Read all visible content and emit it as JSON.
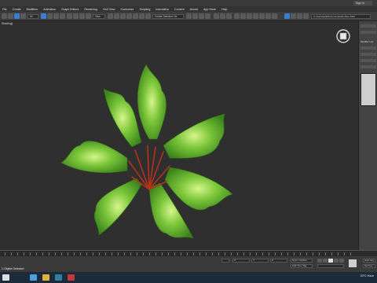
{
  "titlebar": {
    "sign_in": "Sign In"
  },
  "menu": [
    "File",
    "Create",
    "Modifiers",
    "Animation",
    "Graph Editors",
    "Rendering",
    "Civil View",
    "Customize",
    "Scripting",
    "Interactive",
    "Content",
    "Arnold",
    "App Store",
    "Help"
  ],
  "toolbar": {
    "filter_value": "All",
    "view_value": "View",
    "selection_set": "Create Selection Se",
    "workspace_path": "C:\\Users\\dell\\Documents\\3ds Max 2020"
  },
  "viewport": {
    "label": "[+] [Perspective] [Standard] [Default Shading]",
    "label_short": "Shading]"
  },
  "command_panel": {
    "modifier_list": "Modifier List"
  },
  "status": {
    "selected": "1 Object Selected",
    "add_time_tag": "Add Time Tag",
    "grid": "Grid = 10,0cm",
    "x_label": "X:",
    "y_label": "Y:",
    "z_label": "Z:",
    "auto_key": "Auto Key",
    "set_key": "Set Key",
    "selected_dropdown": "Selected",
    "key_filters": "Key Filters..."
  },
  "taskbar": {
    "temperature": "20°C",
    "weather": "Haze",
    "tray_lang": "ENG"
  },
  "colors": {
    "leaf_dark": "#3f8a1f",
    "leaf_mid": "#6bbd2f",
    "leaf_light": "#c6ef7a",
    "stem": "#b5321c",
    "accent": "#3b7ed0"
  }
}
